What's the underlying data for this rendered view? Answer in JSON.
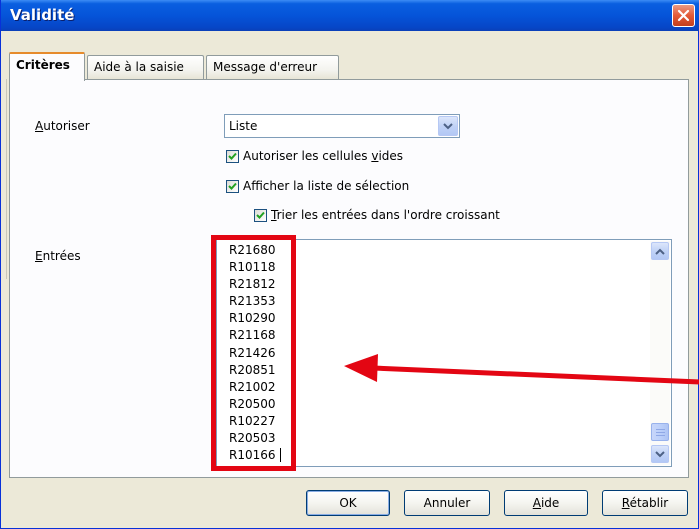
{
  "window": {
    "title": "Validité"
  },
  "tabs": [
    {
      "label": "Critères",
      "active": true
    },
    {
      "label": "Aide à la saisie",
      "active": false
    },
    {
      "label": "Message d'erreur",
      "active": false
    }
  ],
  "form": {
    "allow_label_prefix": "A",
    "allow_label_rest": "utoriser",
    "allow_value": "Liste",
    "entries_label_prefix": "E",
    "entries_label_rest": "ntrées",
    "checkbox_blank": {
      "pre": "Autoriser les cellules ",
      "ul": "v",
      "post": "ides",
      "checked": true
    },
    "checkbox_show": {
      "pre": "Afficher la liste de sélection",
      "checked": true
    },
    "checkbox_sort": {
      "ul": "T",
      "post": "rier les entrées dans l'ordre croissant",
      "checked": true
    }
  },
  "entries": [
    "R21680",
    "R10118",
    "R21812",
    "R21353",
    "R10290",
    "R21168",
    "R21426",
    "R20851",
    "R21002",
    "R20500",
    "R10227",
    "R20503",
    "R10166"
  ],
  "buttons": {
    "ok": "OK",
    "cancel": "Annuler",
    "help_ul": "A",
    "help_rest": "ide",
    "reset_ul": "R",
    "reset_rest": "établir"
  },
  "colors": {
    "titlebar": "#0554d9",
    "annotation_red": "#e30613",
    "tab_highlight": "#e68b2c"
  }
}
